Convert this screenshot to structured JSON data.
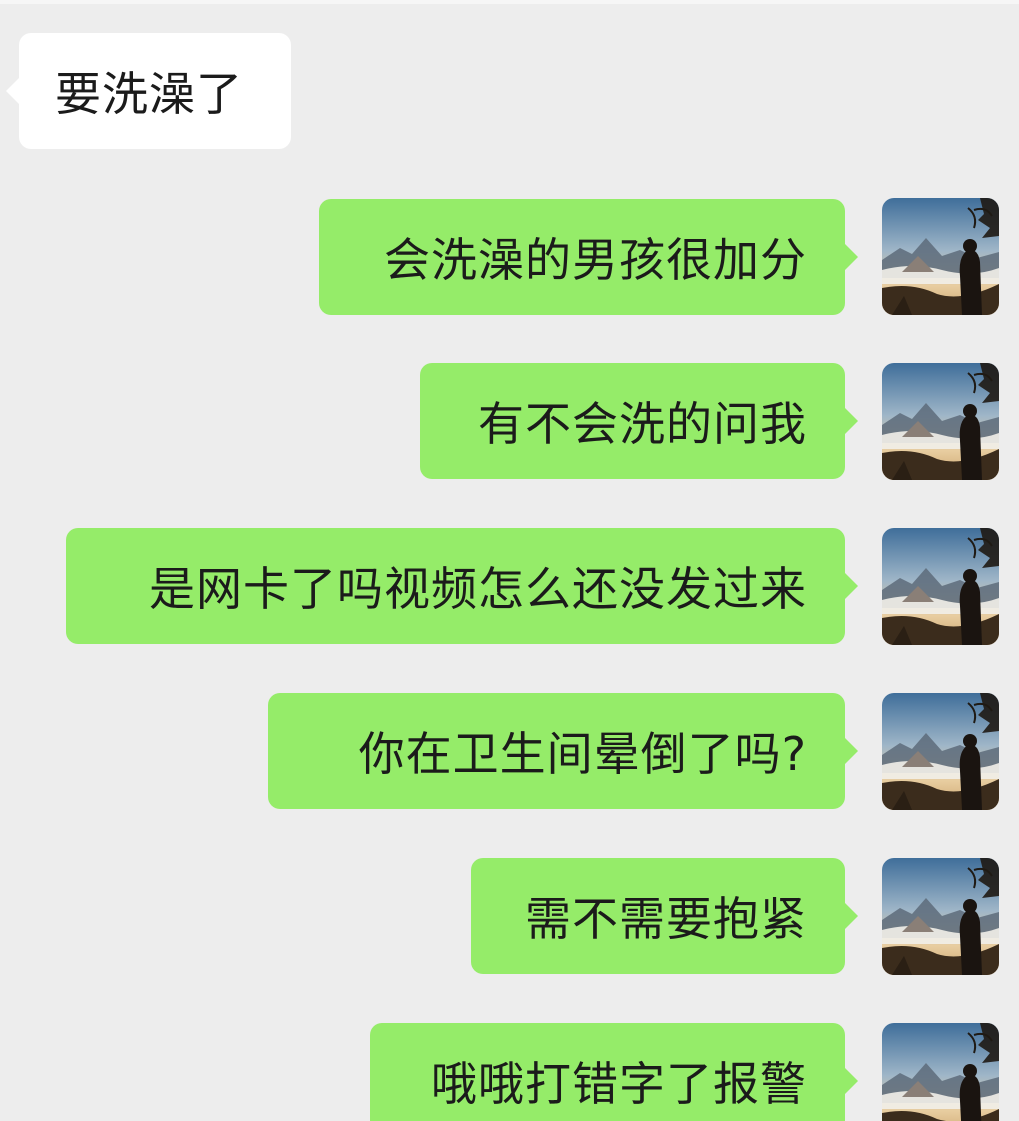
{
  "chat": {
    "incoming": [
      {
        "text": "要洗澡了"
      }
    ],
    "outgoing": [
      {
        "text": "会洗澡的男孩很加分",
        "avatar_icon": "user-avatar-icon"
      },
      {
        "text": "有不会洗的问我",
        "avatar_icon": "user-avatar-icon"
      },
      {
        "text": "是网卡了吗视频怎么还没发过来",
        "avatar_icon": "user-avatar-icon"
      },
      {
        "text": "你在卫生间晕倒了吗?",
        "avatar_icon": "user-avatar-icon"
      },
      {
        "text": "需不需要抱紧",
        "avatar_icon": "user-avatar-icon"
      },
      {
        "text": "哦哦打错字了报警",
        "avatar_icon": "user-avatar-icon"
      }
    ]
  },
  "colors": {
    "background": "#ededed",
    "incoming_bubble": "#ffffff",
    "outgoing_bubble": "#95ec69",
    "text": "#1b1b1b"
  }
}
